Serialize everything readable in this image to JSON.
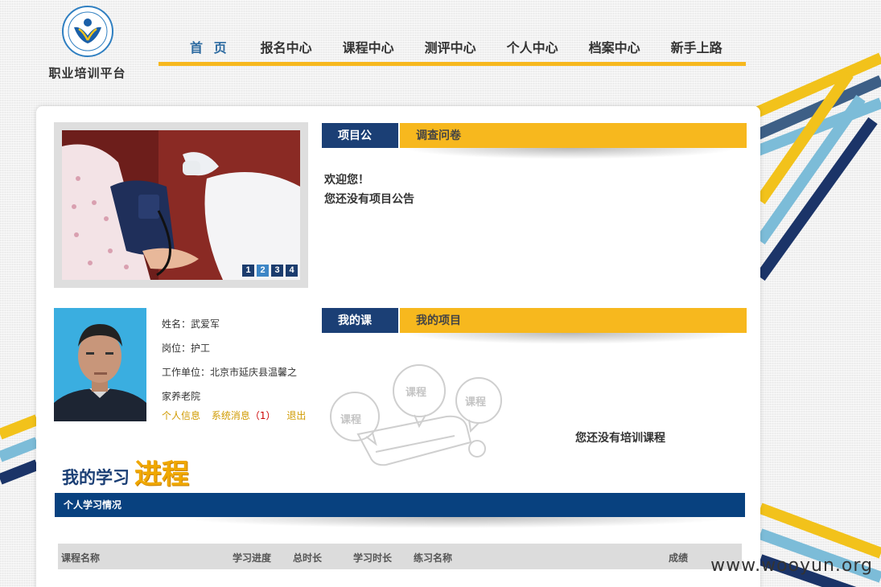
{
  "logo": {
    "text": "职业培训平台"
  },
  "nav": {
    "items": [
      {
        "label": "首 页",
        "active": true
      },
      {
        "label": "报名中心"
      },
      {
        "label": "课程中心"
      },
      {
        "label": "测评中心"
      },
      {
        "label": "个人中心"
      },
      {
        "label": "档案中心"
      },
      {
        "label": "新手上路"
      }
    ]
  },
  "slider": {
    "dots": [
      "1",
      "2",
      "3",
      "4"
    ],
    "active_dot": "2"
  },
  "announcement": {
    "tabs": [
      {
        "label": "项目公告",
        "active": true
      },
      {
        "label": "调查问卷"
      }
    ],
    "welcome": "欢迎您！",
    "empty": "您还没有项目公告"
  },
  "profile": {
    "name": "姓名：武爱军",
    "position": "岗位：护工",
    "employer": "工作单位：北京市延庆县温馨之家养老院",
    "links": {
      "info": "个人信息",
      "messages": "系统消息",
      "message_count": "（1）",
      "logout": "退出"
    }
  },
  "courses": {
    "tabs": [
      {
        "label": "我的课程",
        "active": true
      },
      {
        "label": "我的项目"
      }
    ],
    "empty": "您还没有培训课程",
    "bubble_label": "课程"
  },
  "progress": {
    "banner_small": "我的学习",
    "banner_big": "进程",
    "section_title": "个人学习情况",
    "columns": [
      "课程名称",
      "学习进度",
      "总时长",
      "学习时长",
      "练习名称",
      "成绩"
    ]
  },
  "watermark": "www.wooyun.org",
  "colors": {
    "accent_yellow": "#f7b81e",
    "navy": "#1b3f75",
    "section_blue": "#08417f",
    "nav_active": "#2c6aa0"
  }
}
